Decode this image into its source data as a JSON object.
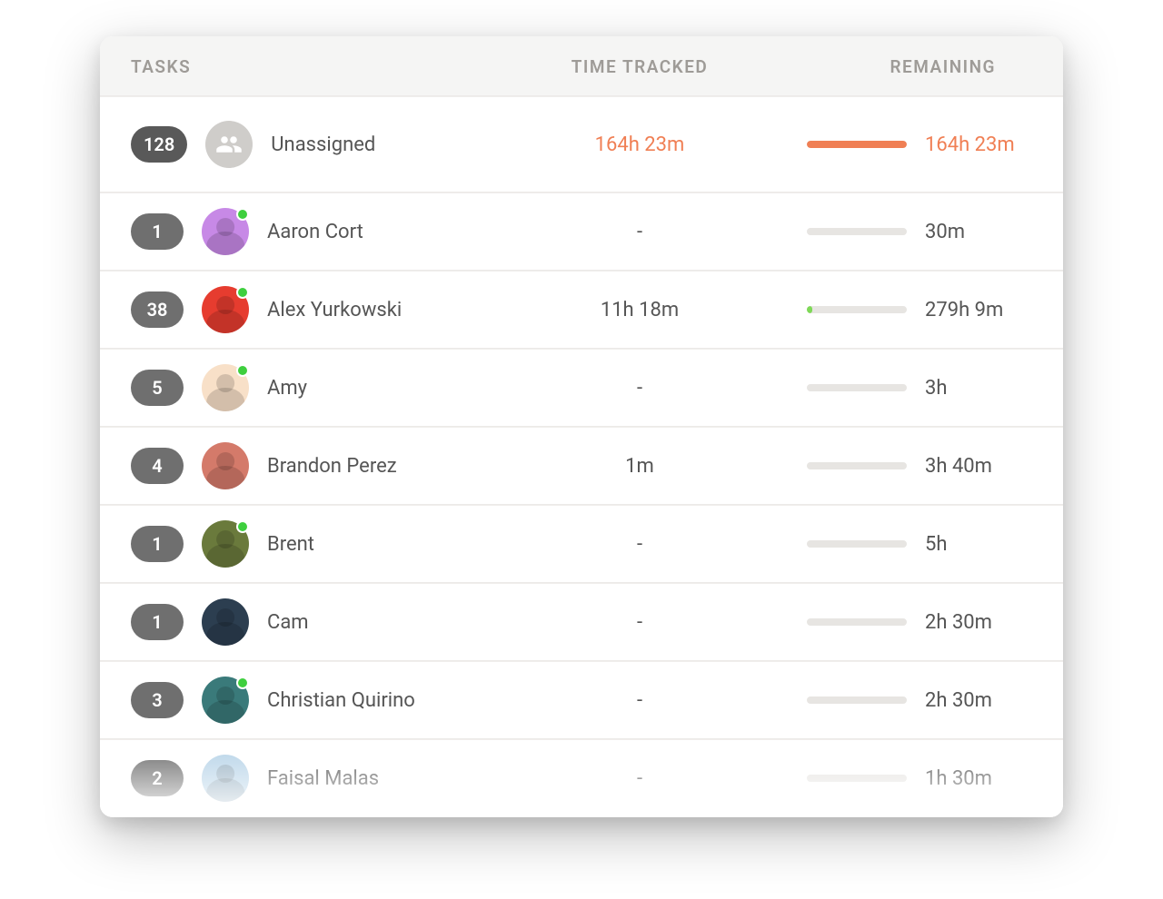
{
  "columns": {
    "tasks": "TASKS",
    "tracked": "TIME TRACKED",
    "remaining": "REMAINING"
  },
  "colors": {
    "accent_orange": "#f07f54",
    "bar_empty": "#e7e5e2",
    "bar_green": "#7ed957"
  },
  "rows": [
    {
      "id": "unassigned",
      "task_count": "128",
      "name": "Unassigned",
      "tracked": "164h 23m",
      "tracked_highlight": true,
      "remaining": "164h 23m",
      "remaining_highlight": true,
      "bar_fill_pct": 100,
      "bar_fill_color": "#f07f54",
      "avatar_bg": "av-unassigned",
      "online": false,
      "is_group": true
    },
    {
      "id": "aaron",
      "task_count": "1",
      "name": "Aaron Cort",
      "tracked": "-",
      "tracked_highlight": false,
      "remaining": "30m",
      "remaining_highlight": false,
      "bar_fill_pct": 0,
      "bar_fill_color": "#e7e5e2",
      "avatar_bg": "av-purple",
      "online": true,
      "is_group": false
    },
    {
      "id": "alex",
      "task_count": "38",
      "name": "Alex Yurkowski",
      "tracked": "11h 18m",
      "tracked_highlight": false,
      "remaining": "279h 9m",
      "remaining_highlight": false,
      "bar_fill_pct": 5,
      "bar_fill_color": "#7ed957",
      "avatar_bg": "av-red",
      "online": true,
      "is_group": false
    },
    {
      "id": "amy",
      "task_count": "5",
      "name": "Amy",
      "tracked": "-",
      "tracked_highlight": false,
      "remaining": "3h",
      "remaining_highlight": false,
      "bar_fill_pct": 0,
      "bar_fill_color": "#e7e5e2",
      "avatar_bg": "av-skin",
      "online": true,
      "is_group": false
    },
    {
      "id": "brandon",
      "task_count": "4",
      "name": "Brandon Perez",
      "tracked": "1m",
      "tracked_highlight": false,
      "remaining": "3h 40m",
      "remaining_highlight": false,
      "bar_fill_pct": 0,
      "bar_fill_color": "#e7e5e2",
      "avatar_bg": "av-peach",
      "online": false,
      "is_group": false
    },
    {
      "id": "brent",
      "task_count": "1",
      "name": "Brent",
      "tracked": "-",
      "tracked_highlight": false,
      "remaining": "5h",
      "remaining_highlight": false,
      "bar_fill_pct": 0,
      "bar_fill_color": "#e7e5e2",
      "avatar_bg": "av-olive",
      "online": true,
      "is_group": false
    },
    {
      "id": "cam",
      "task_count": "1",
      "name": "Cam",
      "tracked": "-",
      "tracked_highlight": false,
      "remaining": "2h 30m",
      "remaining_highlight": false,
      "bar_fill_pct": 0,
      "bar_fill_color": "#e7e5e2",
      "avatar_bg": "av-navy",
      "online": false,
      "is_group": false
    },
    {
      "id": "christian",
      "task_count": "3",
      "name": "Christian Quirino",
      "tracked": "-",
      "tracked_highlight": false,
      "remaining": "2h 30m",
      "remaining_highlight": false,
      "bar_fill_pct": 0,
      "bar_fill_color": "#e7e5e2",
      "avatar_bg": "av-teal",
      "online": true,
      "is_group": false
    },
    {
      "id": "faisal",
      "task_count": "2",
      "name": "Faisal Malas",
      "tracked": "-",
      "tracked_highlight": false,
      "remaining": "1h 30m",
      "remaining_highlight": false,
      "bar_fill_pct": 0,
      "bar_fill_color": "#e7e5e2",
      "avatar_bg": "av-sky",
      "online": false,
      "is_group": false
    }
  ]
}
